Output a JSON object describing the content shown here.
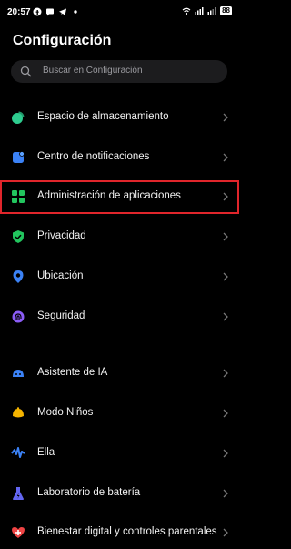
{
  "status_bar": {
    "time": "20:57",
    "battery": "88"
  },
  "header": {
    "title": "Configuración"
  },
  "search": {
    "placeholder": "Buscar en Configuración"
  },
  "settings": {
    "items": [
      {
        "label": "Espacio de almacenamiento",
        "icon": "storage-pie-icon",
        "color": "#2ecc8f"
      },
      {
        "label": "Centro de notificaciones",
        "icon": "notification-icon",
        "color": "#3b82f6"
      },
      {
        "label": "Administración de aplicaciones",
        "icon": "apps-grid-icon",
        "color": "#22c55e",
        "highlighted": true
      },
      {
        "label": "Privacidad",
        "icon": "shield-check-icon",
        "color": "#22c55e"
      },
      {
        "label": "Ubicación",
        "icon": "location-pin-icon",
        "color": "#3b82f6"
      },
      {
        "label": "Seguridad",
        "icon": "fingerprint-icon",
        "color": "#8b5cf6"
      },
      {
        "label": "Asistente de IA",
        "icon": "ai-assistant-icon",
        "color": "#3b82f6"
      },
      {
        "label": "Modo Niños",
        "icon": "kids-mode-icon",
        "color": "#f5b400"
      },
      {
        "label": "Ella",
        "icon": "ella-icon",
        "color": "#3b82f6"
      },
      {
        "label": "Laboratorio de batería",
        "icon": "battery-lab-icon",
        "color": "#6366f1"
      },
      {
        "label": "Bienestar digital y controles parentales",
        "icon": "wellbeing-heart-icon",
        "color": "#ef4444"
      }
    ]
  }
}
